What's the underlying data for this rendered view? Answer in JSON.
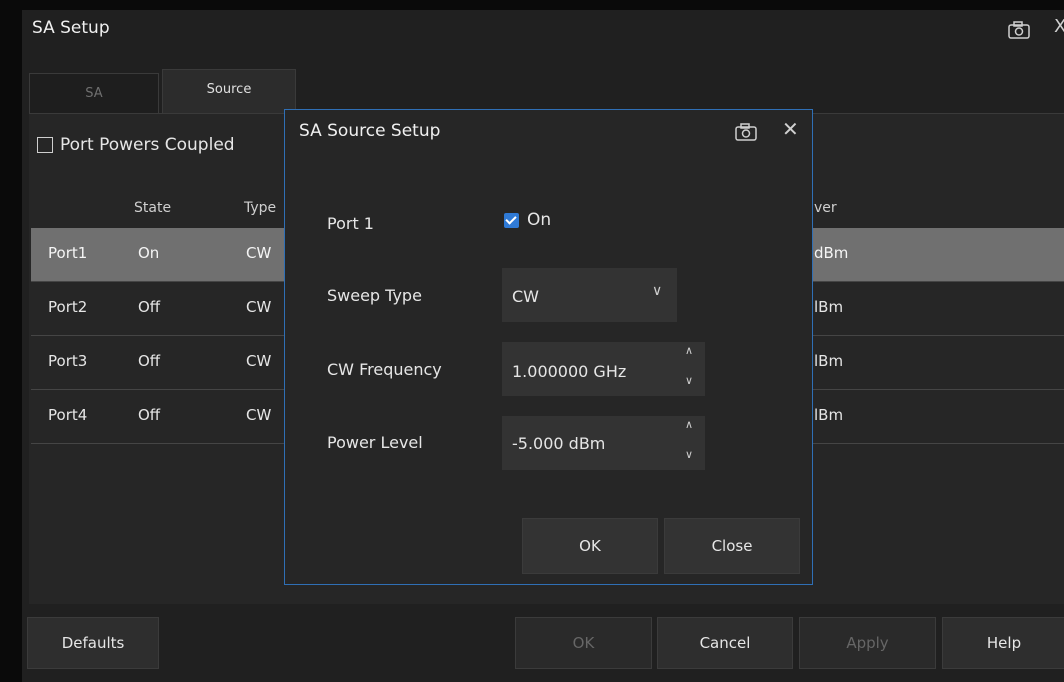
{
  "window": {
    "title": "SA Setup",
    "close_glyph": "X"
  },
  "tabs": [
    {
      "label": "SA",
      "active": false
    },
    {
      "label": "Source",
      "active": true
    }
  ],
  "coupled": {
    "label": "Port Powers Coupled",
    "checked": false
  },
  "table": {
    "headers": {
      "state": "State",
      "type": "Type",
      "power": "ver"
    },
    "rows": [
      {
        "port": "Port1",
        "state": "On",
        "type": "CW",
        "power": "dBm",
        "selected": true
      },
      {
        "port": "Port2",
        "state": "Off",
        "type": "CW",
        "power": "lBm",
        "selected": false
      },
      {
        "port": "Port3",
        "state": "Off",
        "type": "CW",
        "power": "lBm",
        "selected": false
      },
      {
        "port": "Port4",
        "state": "Off",
        "type": "CW",
        "power": "lBm",
        "selected": false
      }
    ]
  },
  "footer": {
    "defaults": "Defaults",
    "ok": "OK",
    "cancel": "Cancel",
    "apply": "Apply",
    "help": "Help"
  },
  "dialog": {
    "title": "SA Source Setup",
    "close_glyph": "✕",
    "port": {
      "label": "Port 1",
      "on_label": "On",
      "checked": true
    },
    "sweep_type": {
      "label": "Sweep Type",
      "value": "CW"
    },
    "cw_frequency": {
      "label": "CW Frequency",
      "value": "1.000000 GHz"
    },
    "power_level": {
      "label": "Power Level",
      "value": "-5.000 dBm"
    },
    "ok": "OK",
    "close": "Close"
  },
  "icons": {
    "camera": "camera-icon",
    "close": "close-icon",
    "chevron": "chevron-down-icon",
    "spin_up": "spin-up-icon",
    "spin_down": "spin-down-icon"
  },
  "colors": {
    "accent": "#2f7ad6",
    "dialog_border": "#2f6fb5",
    "selected_row": "#707070"
  }
}
